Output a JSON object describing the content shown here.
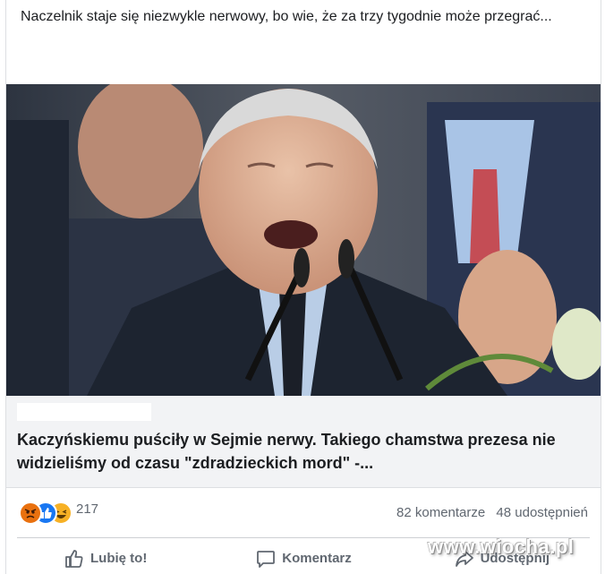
{
  "post": {
    "text": "Naczelnik staje się niezwykle nerwowy, bo wie, że za trzy tygodnie może przegrać..."
  },
  "link_preview": {
    "title": "Kaczyńskiemu puściły w Sejmie nerwy. Takiego chamstwa prezesa nie widzieliśmy od czasu \"zdradzieckich mord\" -..."
  },
  "icons": {
    "info": "i",
    "angry": "angry-reaction",
    "like": "like-reaction",
    "haha": "haha-reaction"
  },
  "stats": {
    "reaction_count": "217",
    "comments": "82 komentarze",
    "shares": "48 udostępnień"
  },
  "actions": {
    "like": "Lubię to!",
    "comment": "Komentarz",
    "share": "Udostępnij"
  },
  "watermark": "www.wiocha.pl",
  "colors": {
    "like_blue": "#1877f2",
    "angry_orange": "#e9710f",
    "haha_yellow": "#f7b125",
    "muted_text": "#606770"
  }
}
